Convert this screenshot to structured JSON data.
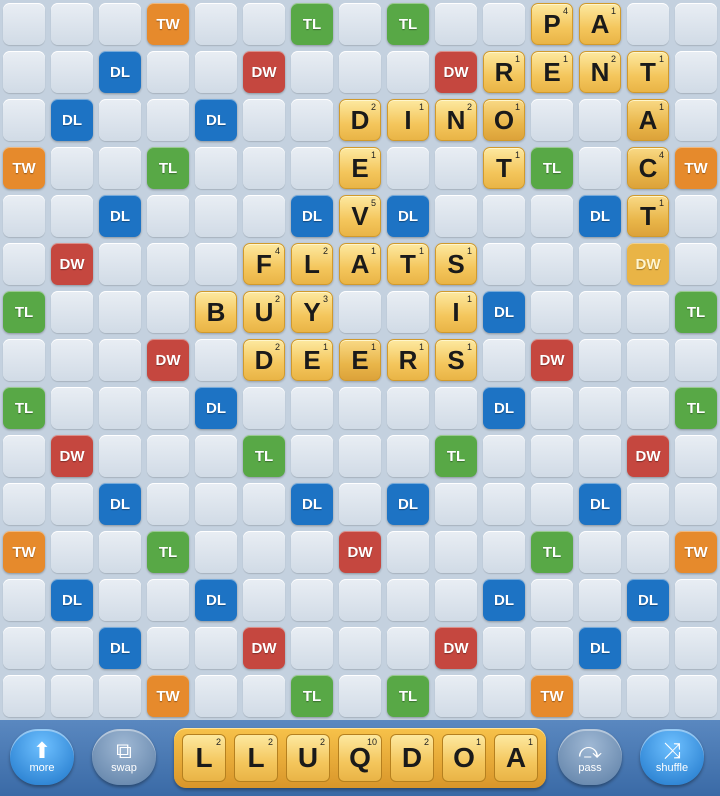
{
  "colors": {
    "TW": "#e68a2c",
    "DW": "#c5473f",
    "TL": "#58a846",
    "DL": "#1d73c4"
  },
  "bonus_squares": [
    {
      "row": 0,
      "col": 3,
      "type": "TW"
    },
    {
      "row": 0,
      "col": 6,
      "type": "TL"
    },
    {
      "row": 0,
      "col": 8,
      "type": "TL"
    },
    {
      "row": 0,
      "col": 11,
      "type": "TW"
    },
    {
      "row": 1,
      "col": 2,
      "type": "DL"
    },
    {
      "row": 1,
      "col": 5,
      "type": "DW"
    },
    {
      "row": 1,
      "col": 9,
      "type": "DW"
    },
    {
      "row": 1,
      "col": 12,
      "type": "DL"
    },
    {
      "row": 2,
      "col": 1,
      "type": "DL"
    },
    {
      "row": 2,
      "col": 4,
      "type": "DL"
    },
    {
      "row": 2,
      "col": 10,
      "type": "DL"
    },
    {
      "row": 2,
      "col": 13,
      "type": "DL"
    },
    {
      "row": 3,
      "col": 0,
      "type": "TW"
    },
    {
      "row": 3,
      "col": 3,
      "type": "TL"
    },
    {
      "row": 3,
      "col": 11,
      "type": "TL"
    },
    {
      "row": 3,
      "col": 14,
      "type": "TW"
    },
    {
      "row": 4,
      "col": 2,
      "type": "DL"
    },
    {
      "row": 4,
      "col": 6,
      "type": "DL"
    },
    {
      "row": 4,
      "col": 8,
      "type": "DL"
    },
    {
      "row": 4,
      "col": 12,
      "type": "DL"
    },
    {
      "row": 5,
      "col": 1,
      "type": "DW"
    },
    {
      "row": 5,
      "col": 13,
      "type": "DW"
    },
    {
      "row": 6,
      "col": 0,
      "type": "TL"
    },
    {
      "row": 6,
      "col": 4,
      "type": "DL"
    },
    {
      "row": 6,
      "col": 10,
      "type": "DL"
    },
    {
      "row": 6,
      "col": 14,
      "type": "TL"
    },
    {
      "row": 7,
      "col": 3,
      "type": "DW"
    },
    {
      "row": 7,
      "col": 11,
      "type": "DW"
    },
    {
      "row": 8,
      "col": 0,
      "type": "TL"
    },
    {
      "row": 8,
      "col": 4,
      "type": "DL"
    },
    {
      "row": 8,
      "col": 10,
      "type": "DL"
    },
    {
      "row": 8,
      "col": 14,
      "type": "TL"
    },
    {
      "row": 9,
      "col": 1,
      "type": "DW"
    },
    {
      "row": 9,
      "col": 5,
      "type": "TL"
    },
    {
      "row": 9,
      "col": 9,
      "type": "TL"
    },
    {
      "row": 9,
      "col": 13,
      "type": "DW"
    },
    {
      "row": 10,
      "col": 2,
      "type": "DL"
    },
    {
      "row": 10,
      "col": 6,
      "type": "DL"
    },
    {
      "row": 10,
      "col": 8,
      "type": "DL"
    },
    {
      "row": 10,
      "col": 12,
      "type": "DL"
    },
    {
      "row": 11,
      "col": 0,
      "type": "TW"
    },
    {
      "row": 11,
      "col": 3,
      "type": "TL"
    },
    {
      "row": 11,
      "col": 7,
      "type": "DW"
    },
    {
      "row": 11,
      "col": 11,
      "type": "TL"
    },
    {
      "row": 11,
      "col": 14,
      "type": "TW"
    },
    {
      "row": 12,
      "col": 1,
      "type": "DL"
    },
    {
      "row": 12,
      "col": 4,
      "type": "DL"
    },
    {
      "row": 12,
      "col": 10,
      "type": "DL"
    },
    {
      "row": 12,
      "col": 13,
      "type": "DL"
    },
    {
      "row": 13,
      "col": 2,
      "type": "DL"
    },
    {
      "row": 13,
      "col": 5,
      "type": "DW"
    },
    {
      "row": 13,
      "col": 9,
      "type": "DW"
    },
    {
      "row": 13,
      "col": 12,
      "type": "DL"
    },
    {
      "row": 14,
      "col": 3,
      "type": "TW"
    },
    {
      "row": 14,
      "col": 6,
      "type": "TL"
    },
    {
      "row": 14,
      "col": 8,
      "type": "TL"
    },
    {
      "row": 14,
      "col": 11,
      "type": "TW"
    }
  ],
  "tiles": [
    {
      "row": 0,
      "col": 11,
      "letter": "P",
      "points": "4",
      "recent": false
    },
    {
      "row": 0,
      "col": 12,
      "letter": "A",
      "points": "1",
      "recent": false
    },
    {
      "row": 1,
      "col": 10,
      "letter": "R",
      "points": "1",
      "recent": false
    },
    {
      "row": 1,
      "col": 11,
      "letter": "E",
      "points": "1",
      "recent": false
    },
    {
      "row": 1,
      "col": 12,
      "letter": "N",
      "points": "2",
      "recent": false
    },
    {
      "row": 1,
      "col": 13,
      "letter": "T",
      "points": "1",
      "recent": false
    },
    {
      "row": 2,
      "col": 7,
      "letter": "D",
      "points": "2",
      "recent": false
    },
    {
      "row": 2,
      "col": 8,
      "letter": "I",
      "points": "1",
      "recent": false
    },
    {
      "row": 2,
      "col": 9,
      "letter": "N",
      "points": "2",
      "recent": false
    },
    {
      "row": 2,
      "col": 10,
      "letter": "O",
      "points": "1",
      "recent": true
    },
    {
      "row": 2,
      "col": 13,
      "letter": "A",
      "points": "1",
      "recent": true
    },
    {
      "row": 3,
      "col": 7,
      "letter": "E",
      "points": "1",
      "recent": false
    },
    {
      "row": 3,
      "col": 10,
      "letter": "T",
      "points": "1",
      "recent": false
    },
    {
      "row": 3,
      "col": 13,
      "letter": "C",
      "points": "4",
      "recent": true
    },
    {
      "row": 4,
      "col": 7,
      "letter": "V",
      "points": "5",
      "recent": false
    },
    {
      "row": 4,
      "col": 13,
      "letter": "T",
      "points": "1",
      "recent": true
    },
    {
      "row": 5,
      "col": 5,
      "letter": "F",
      "points": "4",
      "recent": false
    },
    {
      "row": 5,
      "col": 6,
      "letter": "L",
      "points": "2",
      "recent": false
    },
    {
      "row": 5,
      "col": 7,
      "letter": "A",
      "points": "1",
      "recent": false
    },
    {
      "row": 5,
      "col": 8,
      "letter": "T",
      "points": "1",
      "recent": false
    },
    {
      "row": 5,
      "col": 9,
      "letter": "S",
      "points": "1",
      "recent": false
    },
    {
      "row": 6,
      "col": 4,
      "letter": "B",
      "points": "",
      "recent": false
    },
    {
      "row": 6,
      "col": 5,
      "letter": "U",
      "points": "2",
      "recent": false
    },
    {
      "row": 6,
      "col": 6,
      "letter": "Y",
      "points": "3",
      "recent": false
    },
    {
      "row": 6,
      "col": 9,
      "letter": "I",
      "points": "1",
      "recent": false
    },
    {
      "row": 7,
      "col": 5,
      "letter": "D",
      "points": "2",
      "recent": false
    },
    {
      "row": 7,
      "col": 6,
      "letter": "E",
      "points": "1",
      "recent": false
    },
    {
      "row": 7,
      "col": 7,
      "letter": "E",
      "points": "1",
      "recent": true
    },
    {
      "row": 7,
      "col": 8,
      "letter": "R",
      "points": "1",
      "recent": false
    },
    {
      "row": 7,
      "col": 9,
      "letter": "S",
      "points": "1",
      "recent": false
    }
  ],
  "highlight_dw": {
    "row": 5,
    "col": 13,
    "type": "DW"
  },
  "rack": [
    {
      "letter": "L",
      "points": "2"
    },
    {
      "letter": "L",
      "points": "2"
    },
    {
      "letter": "U",
      "points": "2"
    },
    {
      "letter": "Q",
      "points": "10"
    },
    {
      "letter": "D",
      "points": "2"
    },
    {
      "letter": "O",
      "points": "1"
    },
    {
      "letter": "A",
      "points": "1"
    }
  ],
  "buttons": {
    "more": "more",
    "swap": "swap",
    "pass": "pass",
    "shuffle": "shuffle"
  }
}
